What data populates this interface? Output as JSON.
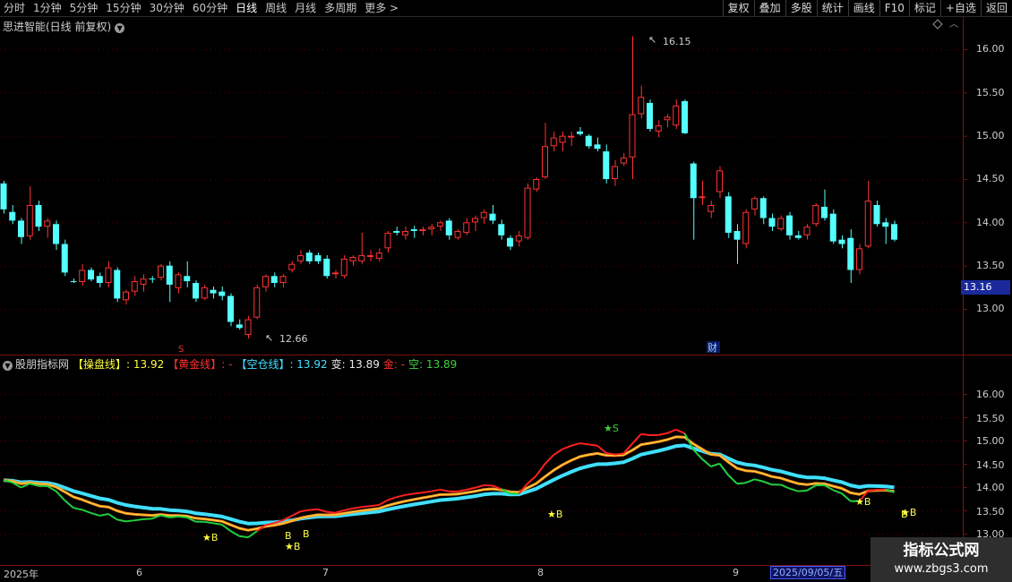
{
  "toolbar": {
    "periods": [
      "分时",
      "1分钟",
      "5分钟",
      "15分钟",
      "30分钟",
      "60分钟",
      "日线",
      "周线",
      "月线",
      "多周期",
      "更多 >"
    ],
    "active_period": "日线",
    "buttons": [
      "复权",
      "叠加",
      "多股",
      "统计",
      "画线",
      "F10",
      "标记",
      "+自选",
      "返回"
    ]
  },
  "main_chart": {
    "title": "思进智能(日线 前复权)",
    "high_label": "16.15",
    "low_label": "12.66",
    "current_price_tag": "13.16",
    "markers": {
      "red_s": "S",
      "cai": "财"
    },
    "y_ticks": [
      "16.00",
      "15.50",
      "15.00",
      "14.50",
      "14.00",
      "13.50",
      "13.00"
    ]
  },
  "indicator": {
    "name": "股朋指标网",
    "segments": [
      {
        "text": "【操盘线】: 13.92",
        "color": "#ffff40"
      },
      {
        "text": "【黄金线】: -",
        "color": "#ff3030"
      },
      {
        "text": "【空仓线】: 13.92",
        "color": "#40e0ff"
      },
      {
        "text": "变: 13.89",
        "color": "#e8e8e8"
      },
      {
        "text": "金: -",
        "color": "#ff3030"
      },
      {
        "text": "空: 13.89",
        "color": "#40d040"
      }
    ],
    "y_ticks": [
      "16.00",
      "15.50",
      "15.00",
      "14.50",
      "14.00",
      "13.50",
      "13.00"
    ],
    "signals": [
      {
        "text": "★B"
      },
      {
        "text": "★B"
      },
      {
        "text": "B"
      },
      {
        "text": "B"
      },
      {
        "text": "★B"
      },
      {
        "text": "★S"
      },
      {
        "text": "★B"
      },
      {
        "text": "★B"
      },
      {
        "text": "B"
      }
    ]
  },
  "date_axis": {
    "labels": [
      "2025年",
      "6",
      "7",
      "8",
      "9"
    ],
    "cursor_date": "2025/09/05/五"
  },
  "watermark": {
    "line1": "指标公式网",
    "line2": "www.zbgs3.com"
  },
  "colors": {
    "up": "#ff3232",
    "down": "#54ffff",
    "border": "#7a1010",
    "grid": "#5a0000"
  },
  "chart_data": {
    "type": "candlestick",
    "ylim": [
      12.5,
      16.4
    ],
    "candles": [
      {
        "o": 14.45,
        "h": 14.48,
        "l": 14.1,
        "c": 14.15
      },
      {
        "o": 14.12,
        "h": 14.2,
        "l": 13.98,
        "c": 14.02
      },
      {
        "o": 14.02,
        "h": 14.05,
        "l": 13.75,
        "c": 13.83
      },
      {
        "o": 13.84,
        "h": 14.42,
        "l": 13.8,
        "c": 14.2
      },
      {
        "o": 14.2,
        "h": 14.25,
        "l": 13.9,
        "c": 13.95
      },
      {
        "o": 13.95,
        "h": 14.05,
        "l": 13.82,
        "c": 14.02
      },
      {
        "o": 13.98,
        "h": 14.02,
        "l": 13.68,
        "c": 13.75
      },
      {
        "o": 13.75,
        "h": 13.8,
        "l": 13.38,
        "c": 13.42
      },
      {
        "o": 13.32,
        "h": 13.35,
        "l": 13.3,
        "c": 13.31
      },
      {
        "o": 13.31,
        "h": 13.52,
        "l": 13.27,
        "c": 13.45
      },
      {
        "o": 13.45,
        "h": 13.48,
        "l": 13.32,
        "c": 13.34
      },
      {
        "o": 13.38,
        "h": 13.42,
        "l": 13.25,
        "c": 13.3
      },
      {
        "o": 13.3,
        "h": 13.55,
        "l": 13.25,
        "c": 13.48
      },
      {
        "o": 13.45,
        "h": 13.48,
        "l": 13.08,
        "c": 13.12
      },
      {
        "o": 13.1,
        "h": 13.22,
        "l": 13.05,
        "c": 13.2
      },
      {
        "o": 13.2,
        "h": 13.38,
        "l": 13.15,
        "c": 13.32
      },
      {
        "o": 13.28,
        "h": 13.4,
        "l": 13.2,
        "c": 13.35
      },
      {
        "o": 13.35,
        "h": 13.38,
        "l": 13.3,
        "c": 13.34
      },
      {
        "o": 13.36,
        "h": 13.52,
        "l": 13.33,
        "c": 13.5
      },
      {
        "o": 13.5,
        "h": 13.55,
        "l": 13.08,
        "c": 13.28
      },
      {
        "o": 13.24,
        "h": 13.42,
        "l": 13.18,
        "c": 13.4
      },
      {
        "o": 13.38,
        "h": 13.55,
        "l": 13.25,
        "c": 13.32
      },
      {
        "o": 13.3,
        "h": 13.33,
        "l": 13.08,
        "c": 13.12
      },
      {
        "o": 13.12,
        "h": 13.28,
        "l": 13.1,
        "c": 13.25
      },
      {
        "o": 13.22,
        "h": 13.26,
        "l": 13.12,
        "c": 13.18
      },
      {
        "o": 13.2,
        "h": 13.26,
        "l": 13.1,
        "c": 13.15
      },
      {
        "o": 13.15,
        "h": 13.18,
        "l": 12.8,
        "c": 12.85
      },
      {
        "o": 12.82,
        "h": 12.88,
        "l": 12.76,
        "c": 12.78
      },
      {
        "o": 12.7,
        "h": 12.92,
        "l": 12.66,
        "c": 12.88
      },
      {
        "o": 12.9,
        "h": 13.28,
        "l": 12.88,
        "c": 13.25
      },
      {
        "o": 13.25,
        "h": 13.4,
        "l": 13.2,
        "c": 13.38
      },
      {
        "o": 13.38,
        "h": 13.42,
        "l": 13.25,
        "c": 13.3
      },
      {
        "o": 13.3,
        "h": 13.4,
        "l": 13.25,
        "c": 13.38
      },
      {
        "o": 13.45,
        "h": 13.55,
        "l": 13.42,
        "c": 13.52
      },
      {
        "o": 13.55,
        "h": 13.68,
        "l": 13.52,
        "c": 13.62
      },
      {
        "o": 13.65,
        "h": 13.68,
        "l": 13.52,
        "c": 13.55
      },
      {
        "o": 13.62,
        "h": 13.65,
        "l": 13.52,
        "c": 13.55
      },
      {
        "o": 13.58,
        "h": 13.62,
        "l": 13.35,
        "c": 13.38
      },
      {
        "o": 13.4,
        "h": 13.45,
        "l": 13.35,
        "c": 13.42
      },
      {
        "o": 13.38,
        "h": 13.62,
        "l": 13.35,
        "c": 13.58
      },
      {
        "o": 13.55,
        "h": 13.62,
        "l": 13.5,
        "c": 13.6
      },
      {
        "o": 13.55,
        "h": 13.88,
        "l": 13.52,
        "c": 13.62
      },
      {
        "o": 13.6,
        "h": 13.68,
        "l": 13.55,
        "c": 13.62
      },
      {
        "o": 13.58,
        "h": 13.7,
        "l": 13.55,
        "c": 13.65
      },
      {
        "o": 13.7,
        "h": 13.9,
        "l": 13.65,
        "c": 13.88
      },
      {
        "o": 13.9,
        "h": 13.95,
        "l": 13.85,
        "c": 13.88
      },
      {
        "o": 13.85,
        "h": 13.95,
        "l": 13.8,
        "c": 13.9
      },
      {
        "o": 13.92,
        "h": 13.96,
        "l": 13.82,
        "c": 13.9
      },
      {
        "o": 13.9,
        "h": 13.95,
        "l": 13.85,
        "c": 13.92
      },
      {
        "o": 13.92,
        "h": 13.98,
        "l": 13.85,
        "c": 13.95
      },
      {
        "o": 13.95,
        "h": 14.02,
        "l": 13.9,
        "c": 14.0
      },
      {
        "o": 14.02,
        "h": 14.05,
        "l": 13.8,
        "c": 13.85
      },
      {
        "o": 13.82,
        "h": 13.92,
        "l": 13.8,
        "c": 13.9
      },
      {
        "o": 13.88,
        "h": 14.05,
        "l": 13.85,
        "c": 14.0
      },
      {
        "o": 14.0,
        "h": 14.08,
        "l": 13.9,
        "c": 14.05
      },
      {
        "o": 14.05,
        "h": 14.15,
        "l": 13.98,
        "c": 14.12
      },
      {
        "o": 14.1,
        "h": 14.2,
        "l": 13.98,
        "c": 14.02
      },
      {
        "o": 13.98,
        "h": 14.03,
        "l": 13.8,
        "c": 13.85
      },
      {
        "o": 13.82,
        "h": 13.85,
        "l": 13.68,
        "c": 13.72
      },
      {
        "o": 13.78,
        "h": 13.9,
        "l": 13.72,
        "c": 13.85
      },
      {
        "o": 13.82,
        "h": 14.45,
        "l": 13.8,
        "c": 14.4
      },
      {
        "o": 14.38,
        "h": 14.52,
        "l": 14.35,
        "c": 14.5
      },
      {
        "o": 14.52,
        "h": 15.15,
        "l": 14.5,
        "c": 14.88
      },
      {
        "o": 14.88,
        "h": 15.05,
        "l": 14.82,
        "c": 14.98
      },
      {
        "o": 14.92,
        "h": 15.05,
        "l": 14.82,
        "c": 15.0
      },
      {
        "o": 14.98,
        "h": 15.05,
        "l": 14.88,
        "c": 15.0
      },
      {
        "o": 15.05,
        "h": 15.1,
        "l": 15.0,
        "c": 15.02
      },
      {
        "o": 15.0,
        "h": 15.02,
        "l": 14.85,
        "c": 14.88
      },
      {
        "o": 14.9,
        "h": 14.98,
        "l": 14.82,
        "c": 14.85
      },
      {
        "o": 14.82,
        "h": 14.9,
        "l": 14.45,
        "c": 14.5
      },
      {
        "o": 14.5,
        "h": 14.72,
        "l": 14.42,
        "c": 14.65
      },
      {
        "o": 14.68,
        "h": 14.8,
        "l": 14.65,
        "c": 14.75
      },
      {
        "o": 14.75,
        "h": 16.15,
        "l": 14.5,
        "c": 15.25
      },
      {
        "o": 15.25,
        "h": 15.58,
        "l": 15.2,
        "c": 15.45
      },
      {
        "o": 15.38,
        "h": 15.42,
        "l": 15.05,
        "c": 15.08
      },
      {
        "o": 15.05,
        "h": 15.18,
        "l": 14.98,
        "c": 15.12
      },
      {
        "o": 15.18,
        "h": 15.25,
        "l": 15.1,
        "c": 15.22
      },
      {
        "o": 15.12,
        "h": 15.42,
        "l": 15.08,
        "c": 15.35
      },
      {
        "o": 15.4,
        "h": 15.42,
        "l": 15.02,
        "c": 15.03
      },
      {
        "o": 14.68,
        "h": 14.7,
        "l": 13.8,
        "c": 14.28
      },
      {
        "o": 14.28,
        "h": 14.48,
        "l": 14.2,
        "c": 14.3
      },
      {
        "o": 14.12,
        "h": 14.25,
        "l": 14.05,
        "c": 14.2
      },
      {
        "o": 14.35,
        "h": 14.65,
        "l": 14.28,
        "c": 14.6
      },
      {
        "o": 14.3,
        "h": 14.35,
        "l": 13.82,
        "c": 13.88
      },
      {
        "o": 13.9,
        "h": 13.98,
        "l": 13.52,
        "c": 13.8
      },
      {
        "o": 13.75,
        "h": 14.15,
        "l": 13.7,
        "c": 14.12
      },
      {
        "o": 14.15,
        "h": 14.3,
        "l": 14.08,
        "c": 14.28
      },
      {
        "o": 14.28,
        "h": 14.3,
        "l": 13.98,
        "c": 14.05
      },
      {
        "o": 14.05,
        "h": 14.1,
        "l": 13.9,
        "c": 13.95
      },
      {
        "o": 13.92,
        "h": 14.08,
        "l": 13.9,
        "c": 14.05
      },
      {
        "o": 14.08,
        "h": 14.12,
        "l": 13.8,
        "c": 13.85
      },
      {
        "o": 13.85,
        "h": 13.9,
        "l": 13.8,
        "c": 13.82
      },
      {
        "o": 13.85,
        "h": 13.98,
        "l": 13.8,
        "c": 13.95
      },
      {
        "o": 13.98,
        "h": 14.22,
        "l": 13.95,
        "c": 14.2
      },
      {
        "o": 14.18,
        "h": 14.38,
        "l": 14.02,
        "c": 14.05
      },
      {
        "o": 14.1,
        "h": 14.15,
        "l": 13.75,
        "c": 13.78
      },
      {
        "o": 13.8,
        "h": 13.85,
        "l": 13.7,
        "c": 13.75
      },
      {
        "o": 13.82,
        "h": 13.92,
        "l": 13.3,
        "c": 13.45
      },
      {
        "o": 13.45,
        "h": 13.75,
        "l": 13.4,
        "c": 13.7
      },
      {
        "o": 13.72,
        "h": 14.48,
        "l": 13.7,
        "c": 14.25
      },
      {
        "o": 14.2,
        "h": 14.25,
        "l": 13.95,
        "c": 13.98
      },
      {
        "o": 14.0,
        "h": 14.05,
        "l": 13.75,
        "c": 13.95
      },
      {
        "o": 13.98,
        "h": 14.02,
        "l": 13.78,
        "c": 13.8
      }
    ]
  }
}
